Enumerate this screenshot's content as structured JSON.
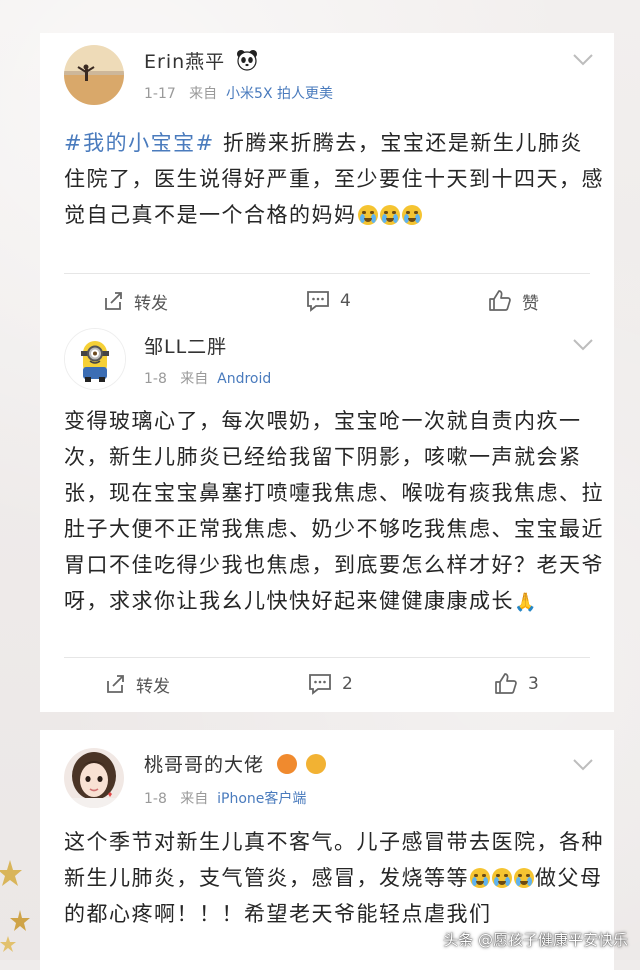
{
  "posts": [
    {
      "username": "Erin燕平",
      "date": "1-17",
      "from_label": "来自",
      "source": "小米5X 拍人更美",
      "hashtag": "#我的小宝宝#",
      "text": " 折腾来折腾去，宝宝还是新生儿肺炎住院了，医生说得好严重，至少要住十天到十四天，感觉自己真不是一个合格的妈妈",
      "repost_label": "转发",
      "comment_count": "4",
      "like_label": "赞"
    },
    {
      "username": "邹LL二胖",
      "date": "1-8",
      "from_label": "来自",
      "source": "Android",
      "text": "变得玻璃心了，每次喂奶，宝宝呛一次就自责内疚一次，新生儿肺炎已经给我留下阴影，咳嗽一声就会紧张，现在宝宝鼻塞打喷嚏我焦虑、喉咙有痰我焦虑、拉肚子大便不正常我焦虑、奶少不够吃我焦虑、宝宝最近胃口不佳吃得少我也焦虑，到底要怎么样才好？老天爷呀，求求你让我幺儿快快好起来健健康康成长",
      "repost_label": "转发",
      "comment_count": "2",
      "like_count": "3"
    },
    {
      "username": "桃哥哥的大佬",
      "date": "1-8",
      "from_label": "来自",
      "source": "iPhone客户端",
      "text_a": "这个季节对新生儿真不客气。儿子感冒带去医院，各种新生儿肺炎，支气管炎，感冒，发烧等等",
      "text_b": "做父母的都心疼啊！！！希望老天爷能轻点虐我们"
    }
  ],
  "watermark": "头条 @愿孩子健康平安快乐",
  "icons": {
    "panda": "panda-emoji",
    "cry": "crying-emoji",
    "pray": "praying-hands-emoji",
    "repost": "repost-icon",
    "comment": "comment-icon",
    "like": "thumbs-up-icon",
    "chevron": "chevron-down-icon"
  },
  "colors": {
    "link": "#4a7bbd",
    "meta": "#9a9a9a"
  }
}
